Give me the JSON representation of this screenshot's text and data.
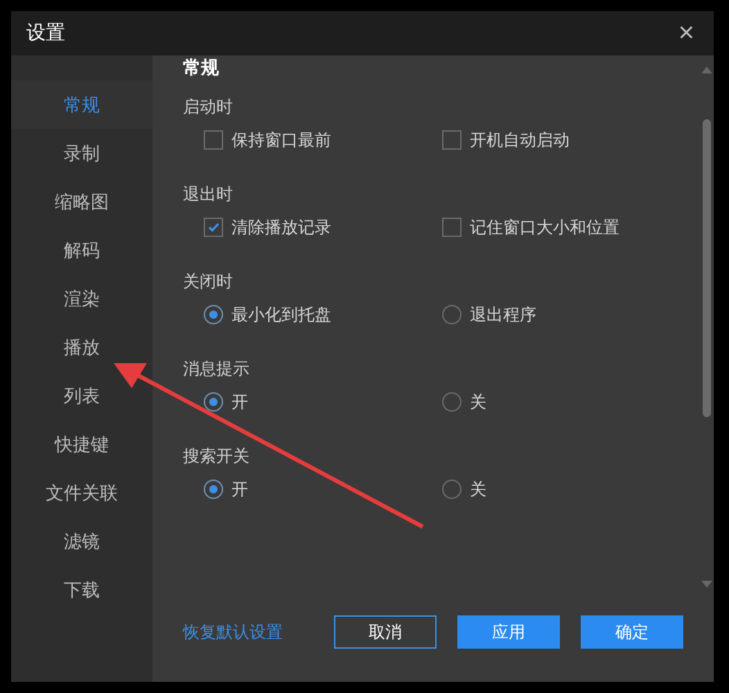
{
  "window": {
    "title": "设置",
    "close": "×"
  },
  "sidebar": {
    "items": [
      {
        "label": "常规",
        "selected": true
      },
      {
        "label": "录制",
        "selected": false
      },
      {
        "label": "缩略图",
        "selected": false
      },
      {
        "label": "解码",
        "selected": false
      },
      {
        "label": "渲染",
        "selected": false
      },
      {
        "label": "播放",
        "selected": false
      },
      {
        "label": "列表",
        "selected": false
      },
      {
        "label": "快捷键",
        "selected": false
      },
      {
        "label": "文件关联",
        "selected": false
      },
      {
        "label": "滤镜",
        "selected": false
      },
      {
        "label": "下载",
        "selected": false
      }
    ]
  },
  "section_title": "常规",
  "groups": [
    {
      "label": "启动时",
      "kind": "checkbox",
      "options": [
        {
          "label": "保持窗口最前",
          "checked": false
        },
        {
          "label": "开机自动启动",
          "checked": false
        }
      ]
    },
    {
      "label": "退出时",
      "kind": "checkbox",
      "options": [
        {
          "label": "清除播放记录",
          "checked": true
        },
        {
          "label": "记住窗口大小和位置",
          "checked": false
        }
      ]
    },
    {
      "label": "关闭时",
      "kind": "radio",
      "options": [
        {
          "label": "最小化到托盘",
          "selected": true
        },
        {
          "label": "退出程序",
          "selected": false
        }
      ]
    },
    {
      "label": "消息提示",
      "kind": "radio",
      "options": [
        {
          "label": "开",
          "selected": true
        },
        {
          "label": "关",
          "selected": false
        }
      ]
    },
    {
      "label": "搜索开关",
      "kind": "radio",
      "options": [
        {
          "label": "开",
          "selected": true
        },
        {
          "label": "关",
          "selected": false
        }
      ]
    }
  ],
  "footer": {
    "reset_link": "恢复默认设置",
    "buttons": [
      {
        "label": "取消",
        "kind": "outline"
      },
      {
        "label": "应用",
        "kind": "primary"
      },
      {
        "label": "确定",
        "kind": "primary"
      }
    ]
  }
}
